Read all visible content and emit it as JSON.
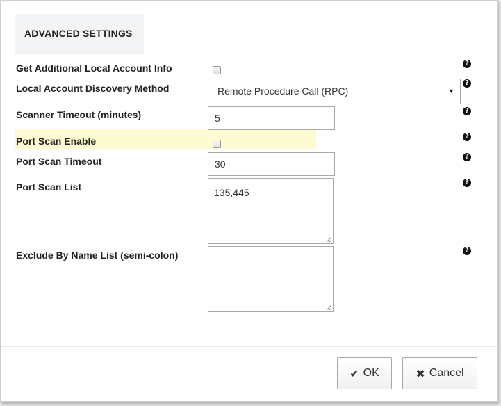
{
  "section": {
    "title": "ADVANCED SETTINGS"
  },
  "fields": {
    "get_additional_local_account_info": {
      "label": "Get Additional Local Account Info"
    },
    "local_account_discovery_method": {
      "label": "Local Account Discovery Method",
      "value": "Remote Procedure Call (RPC)"
    },
    "scanner_timeout": {
      "label": "Scanner Timeout (minutes)",
      "value": "5"
    },
    "port_scan_enable": {
      "label": "Port Scan Enable"
    },
    "port_scan_timeout": {
      "label": "Port Scan Timeout",
      "value": "30"
    },
    "port_scan_list": {
      "label": "Port Scan List",
      "value": "135,445"
    },
    "exclude_by_name_list": {
      "label": "Exclude By Name List (semi-colon)",
      "value": ""
    }
  },
  "help_glyph": "?",
  "buttons": {
    "ok": {
      "label": "OK",
      "icon": "check-icon"
    },
    "cancel": {
      "label": "Cancel",
      "icon": "x-icon"
    }
  },
  "colors": {
    "highlight": "#fdfbd2",
    "section_bg": "#f3f4f6"
  }
}
